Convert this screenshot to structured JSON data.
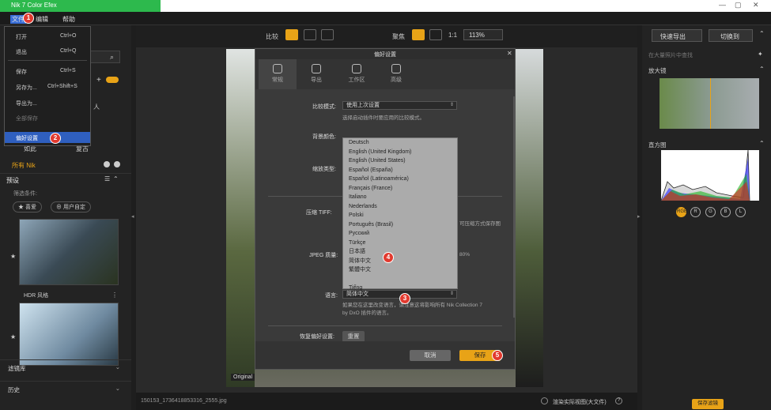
{
  "app": {
    "title": "Nik 7 Color Efex"
  },
  "menu": {
    "file": "文件",
    "edit": "编辑",
    "help": "帮助"
  },
  "file_menu": {
    "items": [
      {
        "label": "打开",
        "shortcut": "Ctrl+O"
      },
      {
        "label": "退出",
        "shortcut": "Ctrl+Q"
      },
      {
        "label": "保存",
        "shortcut": "Ctrl+S"
      },
      {
        "label": "另存为...",
        "shortcut": "Ctrl+Shift+S"
      },
      {
        "label": "导出为...",
        "shortcut": ""
      },
      {
        "label": "全部保存",
        "shortcut": ""
      },
      {
        "label": "偏好设置",
        "shortcut": ""
      }
    ]
  },
  "toolbar": {
    "compare": "比较",
    "focus": "聚焦",
    "ratio": "1:1",
    "zoom": "113%",
    "quick_export": "快速导出",
    "switch_to": "切换到"
  },
  "left": {
    "all_nik": "所有 Nik",
    "presets": "预设",
    "presets_hint": "筛选条件:",
    "fav_chip": "★ 喜爱",
    "user_chip": "⊕ 用户自定",
    "thumb1_label": "HDR 风格",
    "filter_lib": "滤镜库",
    "history": "历史",
    "row_a": "如此",
    "row_b": "复古",
    "side_a": "人"
  },
  "right": {
    "filter_hint": "在大量照片中查找",
    "zoomer": "放大镜",
    "histogram": "直方图",
    "channels": [
      "RGB",
      "R",
      "G",
      "B",
      "L"
    ],
    "save_settings": "保存滤镜"
  },
  "status": {
    "filename": "150153_1736418853316_2555.jpg",
    "compare_toggle": "渲染实际视图(大文件)",
    "original": "Original"
  },
  "dialog": {
    "title": "偏好设置",
    "tabs": [
      "常规",
      "导出",
      "工作区",
      "高级"
    ],
    "compare_mode_label": "比较模式:",
    "compare_mode_value": "使用上次设置",
    "compare_mode_hint": "选择启动插件时要应用的比较模式。",
    "bg_label": "背景颜色:",
    "zoom_label": "缩放类型:",
    "tiff_label": "压缩 TIFF:",
    "tiff_hint": "可压缩方式保存图",
    "jpeg_label": "JPEG 质量:",
    "jpeg_hint": "80%",
    "language_label": "语言:",
    "language_value": "简体中文",
    "language_hint": "如果您在这里改变语言，请注意这将影响所有 Nik Collection 7 by DxO 插件的语言。",
    "reset_label": "恢复偏好设置:",
    "reset_button": "重置",
    "cancel": "取消",
    "save": "保存"
  },
  "languages": [
    "Deutsch",
    "English (United Kingdom)",
    "English (United States)",
    "Español (España)",
    "Español (Latinoamérica)",
    "Français (France)",
    "Italiano",
    "Nederlands",
    "Polski",
    "Português (Brasil)",
    "Русский",
    "Türkçe",
    "日本語",
    "简体中文",
    "繁體中文",
    "",
    "Tiếng"
  ],
  "badges": [
    "1",
    "2",
    "3",
    "4",
    "5"
  ],
  "colors": {
    "accent": "#e8a317",
    "badge": "#e23a2f",
    "green": "#2db94d"
  }
}
